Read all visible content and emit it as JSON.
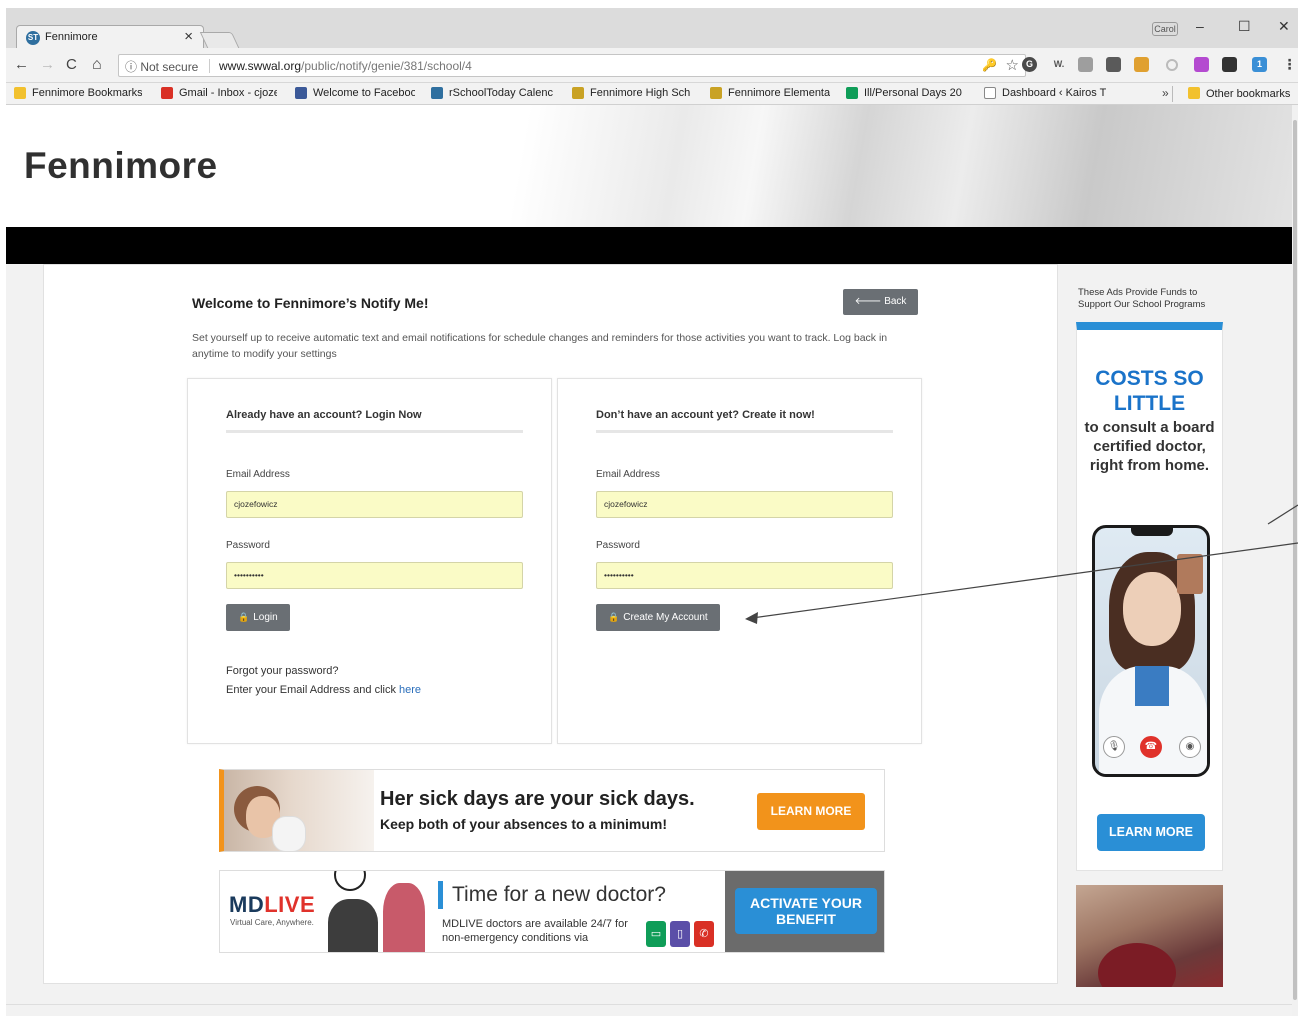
{
  "browser": {
    "tab_title": "Fennimore",
    "tab_close": "×",
    "user_chip": "Carol",
    "window": {
      "minimize": "–",
      "maximize": "☐",
      "close": "✕"
    },
    "nav": {
      "back": "←",
      "forward": "→",
      "reload": "C",
      "home": "⌂"
    },
    "address": {
      "security": "ⓘ Not secure",
      "host": "www.swwal.org",
      "path": "/public/notify/genie/381/school/4"
    },
    "key_glyph": "🔑",
    "star": "☆",
    "extensions": [
      "W.",
      "1",
      "⋮"
    ],
    "bookmarks": [
      {
        "label": "Fennimore Bookmarks",
        "icon": "folder-icon",
        "color": "#f2c12e"
      },
      {
        "label": "Gmail - Inbox - cjoze",
        "icon": "gmail-icon",
        "color": "#d93025"
      },
      {
        "label": "Welcome to Faceboo",
        "icon": "facebook-icon",
        "color": "#3b5998"
      },
      {
        "label": "rSchoolToday Calenc",
        "icon": "rschooltoday-icon",
        "color": "#2f6f9f"
      },
      {
        "label": "Fennimore High Sch",
        "icon": "school-icon",
        "color": "#c9a224"
      },
      {
        "label": "Fennimore Elementa",
        "icon": "school-icon",
        "color": "#c9a224"
      },
      {
        "label": "Ill/Personal Days 20",
        "icon": "sheets-icon",
        "color": "#0f9d58"
      },
      {
        "label": "Dashboard ‹ Kairos T",
        "icon": "page-icon",
        "color": "#ffffff"
      }
    ],
    "bookmarks_more": "»",
    "other_bookmarks": "Other bookmarks"
  },
  "page": {
    "site_title": "Fennimore",
    "welcome": "Welcome to Fennimore’s Notify Me!",
    "back_button": "Back",
    "back_arrow": "🡐",
    "intro": "Set yourself up to receive automatic text and email notifications for schedule changes and reminders for those activities you want to track. Log back in anytime to modify your settings",
    "login": {
      "heading": "Already have an account? Login Now",
      "email_label": "Email Address",
      "email_value": "cjozefowicz",
      "password_label": "Password",
      "password_value": "••••••••••",
      "button": "Login",
      "forgot_line1": "Forgot your password?",
      "forgot_line2": "Enter your Email Address and click",
      "forgot_link": "here"
    },
    "signup": {
      "heading": "Don’t have an account yet? Create it now!",
      "email_label": "Email Address",
      "email_value": "cjozefowicz",
      "password_label": "Password",
      "password_value": "••••••••••",
      "button": "Create My Account"
    },
    "lock_glyph": "🔒"
  },
  "ads": {
    "note": "These Ads Provide Funds to Support Our School Programs",
    "banner1": {
      "title": "Her sick days are your sick days.",
      "subtitle": "Keep both of your absences to a minimum!",
      "cta": "LEARN MORE"
    },
    "banner2": {
      "logo_md": "MD",
      "logo_live": "LIVE",
      "tagline": "Virtual Care, Anywhere.",
      "title": "Time for a new doctor?",
      "body": "MDLIVE doctors are available 24/7 for non-emergency conditions via",
      "cta": "ACTIVATE YOUR BENEFIT"
    },
    "sidebar": {
      "title": "COSTS SO LITTLE",
      "text": "to consult a board certified doctor, right from home.",
      "cta": "LEARN MORE"
    }
  }
}
